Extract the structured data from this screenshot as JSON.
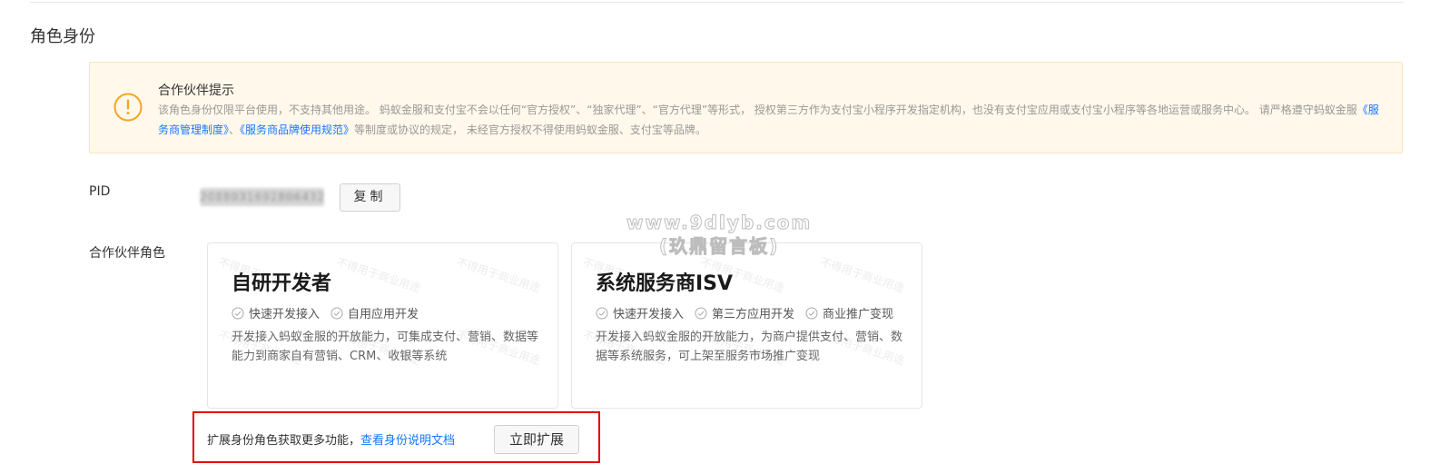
{
  "section": {
    "title": "角色身份"
  },
  "alert": {
    "icon": "exclamation-circle-icon",
    "color": "#f5a623",
    "title": "合作伙伴提示",
    "body_1": "该角色身份仅限平台使用，不支持其他用途。 蚂蚁金服和支付宝不会以任何“官方授权”、“独家代理”、“官方代理”等形式， 授权第三方作为支付宝小程序开发指定机构，也没有支付宝应用或支付宝小程序等各地运营或服务中心。 请严格遵守蚂蚁金服",
    "link_1": "《服务商管理制度》",
    "sep": "、",
    "link_2": "《服务商品牌使用规范》",
    "body_2": "等制度或协议的规定， 未经官方授权不得使用蚂蚁金服、支付宝等品牌。",
    "link_color": "#1677ff"
  },
  "pid": {
    "label": "PID",
    "value": "2088031692806432",
    "copy_label": "复制"
  },
  "roles": {
    "label": "合作伙伴角色",
    "cards": [
      {
        "title": "自研开发者",
        "tags": [
          "快速开发接入",
          "自用应用开发"
        ],
        "desc": "开发接入蚂蚁金服的开放能力，可集成支付、营销、数据等能力到商家自有营销、CRM、收银等系统"
      },
      {
        "title": "系统服务商ISV",
        "tags": [
          "快速开发接入",
          "第三方应用开发",
          "商业推广变现"
        ],
        "desc": "开发接入蚂蚁金服的开放能力，为商户提供支付、营销、数据等系统服务，可上架至服务市场推广变现"
      }
    ],
    "watermark": "不得用于商业用途"
  },
  "site_watermark": {
    "line_1": "www.9dlyb.com",
    "line_2": "(玖鼎留言板)"
  },
  "expand": {
    "text": "扩展身份角色获取更多功能，",
    "link": "查看身份说明文档",
    "button": "立即扩展",
    "highlight_color": "#e30000"
  }
}
